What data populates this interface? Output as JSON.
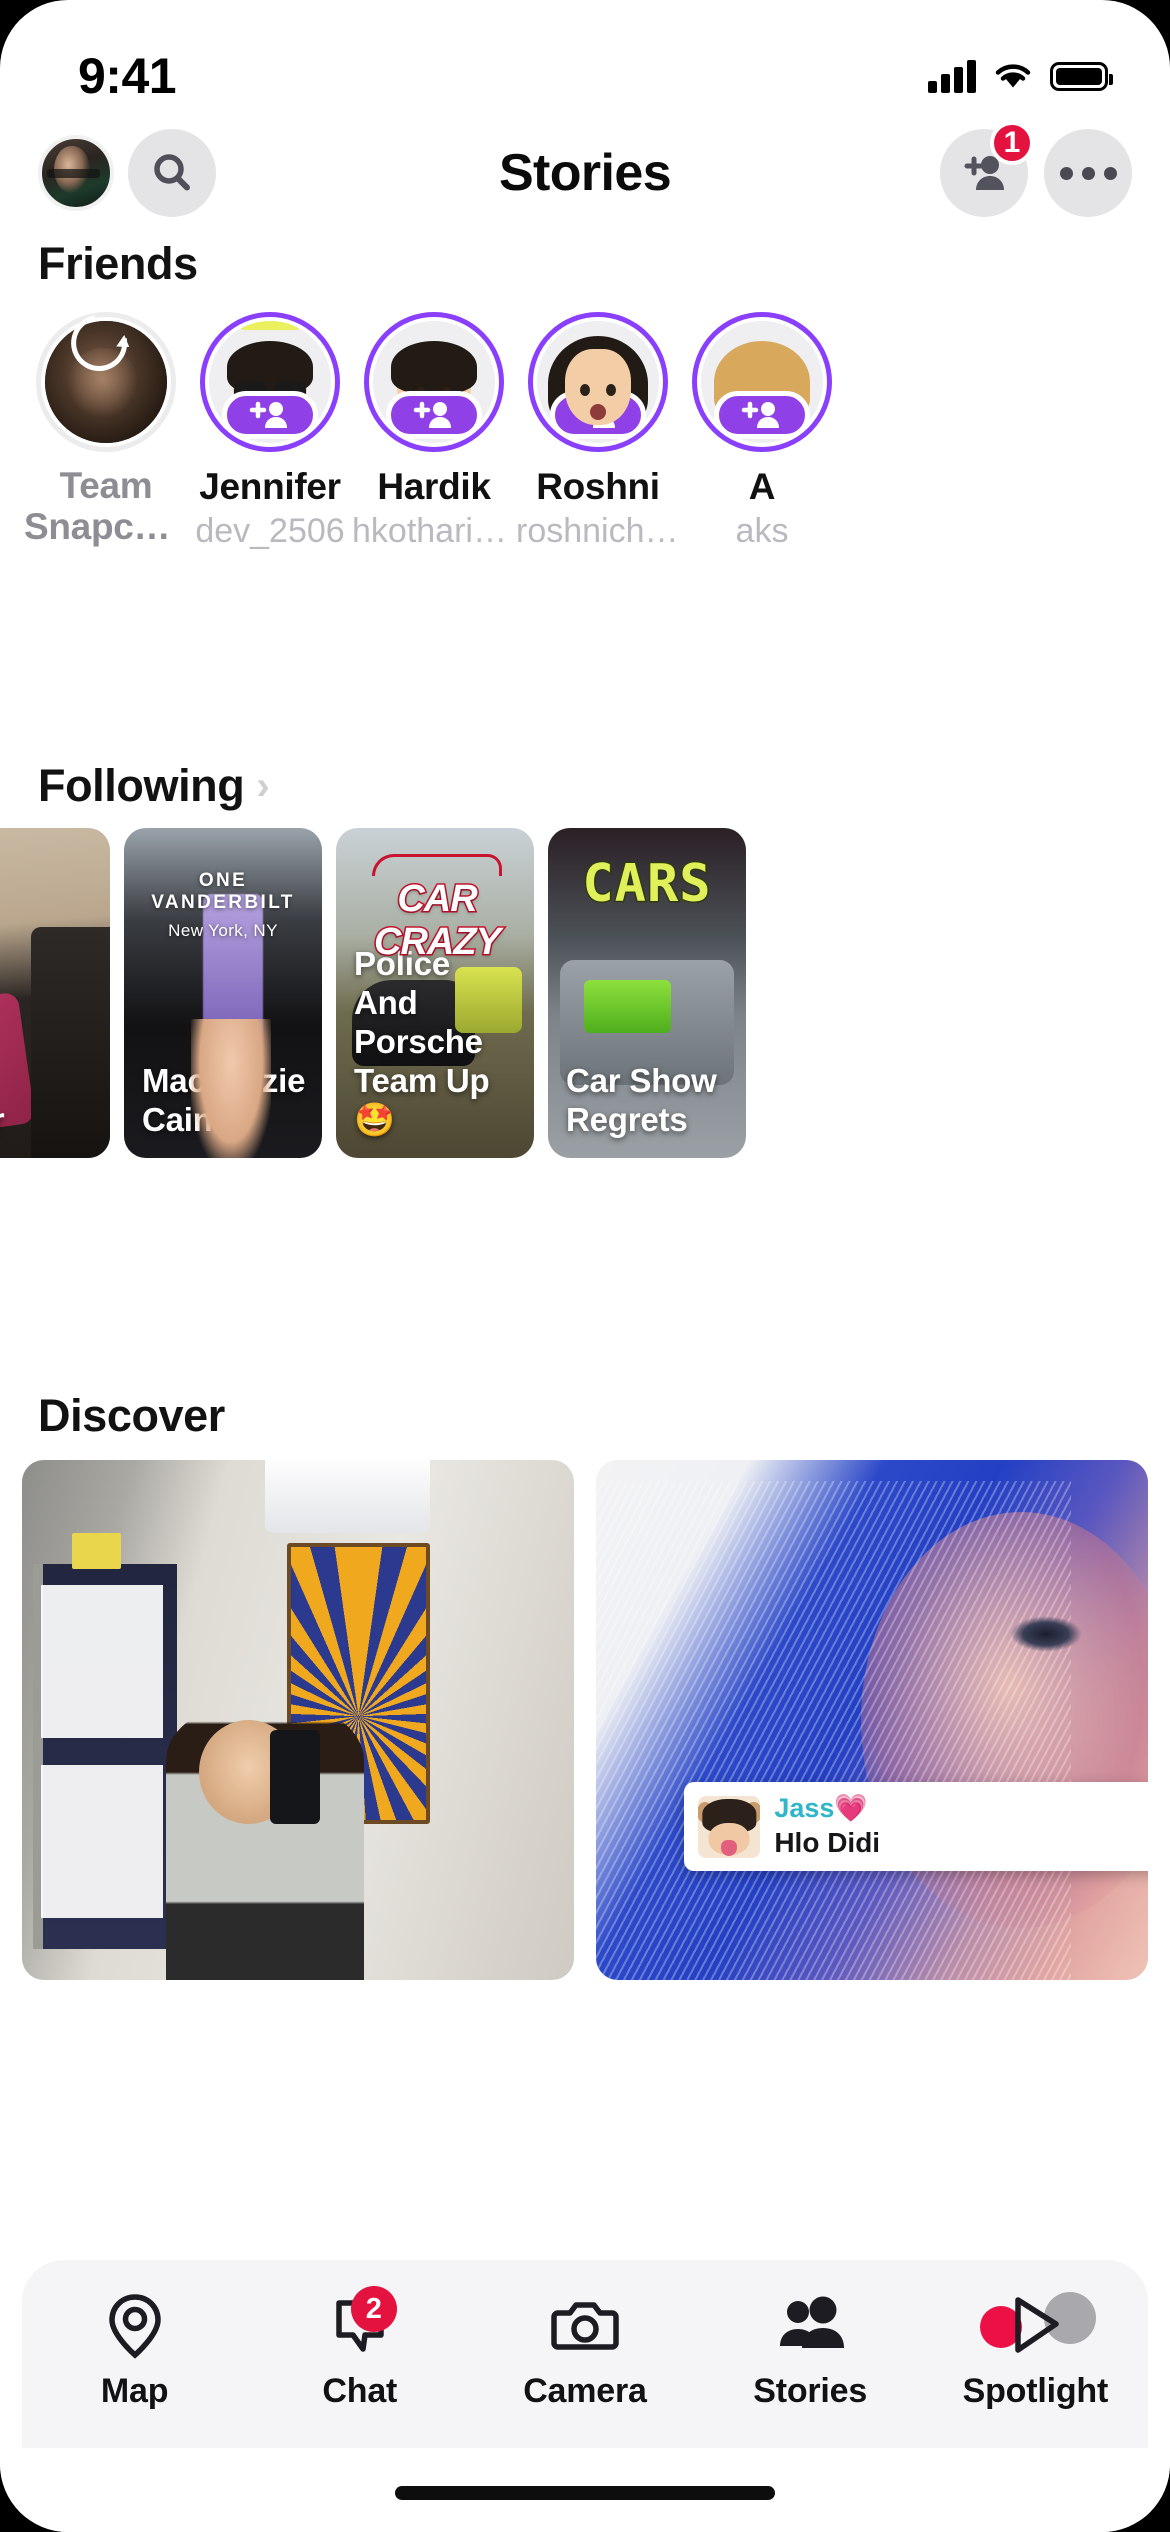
{
  "status_bar": {
    "time": "9:41"
  },
  "header": {
    "title": "Stories",
    "avatar_name": "profile-avatar",
    "search_label": "Search",
    "add_friend_badge": "1",
    "more_label": "More"
  },
  "friends_section": {
    "title": "Friends",
    "items": [
      {
        "name": "Team Snapchat",
        "username": "",
        "type": "photo",
        "ring": "gray",
        "muted": true,
        "has_add": false,
        "refreshing": true
      },
      {
        "name": "Jennifer",
        "username": "dev_2506",
        "type": "bitmoji-sunglasses",
        "ring": "purple",
        "muted": false,
        "has_add": true,
        "refreshing": false
      },
      {
        "name": "Hardik",
        "username": "hkothari1510",
        "type": "bitmoji-male",
        "ring": "purple",
        "muted": false,
        "has_add": true,
        "refreshing": false
      },
      {
        "name": "Roshni",
        "username": "roshnichav…",
        "type": "bitmoji-female",
        "ring": "purple",
        "muted": false,
        "has_add": true,
        "refreshing": false
      },
      {
        "name": "A",
        "username": "aks",
        "type": "bitmoji-blonde",
        "ring": "purple",
        "muted": false,
        "has_add": true,
        "refreshing": false
      }
    ]
  },
  "following_section": {
    "title": "Following",
    "chevron": "›",
    "cards": [
      {
        "title": "Kaur",
        "overlay": "",
        "overlay_sub": "",
        "style": "c1"
      },
      {
        "title": "Mackenzie Cain",
        "overlay": "ONE VANDERBILT",
        "overlay_sub": "New York, NY",
        "style": "c2"
      },
      {
        "title": "Police And Porsche Team Up 🤩",
        "overlay": "CAR CRAZY",
        "overlay_sub": "",
        "style": "c3"
      },
      {
        "title": "Car Show Regrets",
        "overlay": "CARS",
        "overlay_sub": "",
        "style": "c4"
      }
    ]
  },
  "discover_section": {
    "title": "Discover",
    "cards": [
      {
        "style": "d1",
        "chat": null
      },
      {
        "style": "d2",
        "chat": {
          "name": "Jass",
          "heart": "💗",
          "message": "Hlo Didi"
        }
      }
    ]
  },
  "bottom_nav": {
    "items": [
      {
        "label": "Map",
        "icon": "map-pin-icon",
        "badge": "",
        "active": false
      },
      {
        "label": "Chat",
        "icon": "chat-bubble-icon",
        "badge": "2",
        "active": false
      },
      {
        "label": "Camera",
        "icon": "camera-icon",
        "badge": "",
        "active": false
      },
      {
        "label": "Stories",
        "icon": "people-icon",
        "badge": "",
        "active": true
      },
      {
        "label": "Spotlight",
        "icon": "play-triangle-icon",
        "badge": "",
        "active": false
      }
    ]
  },
  "colors": {
    "accent_purple": "#8f40e6",
    "badge_red": "#e3123f",
    "nav_bg": "#f5f5f7",
    "chat_name_teal": "#2fb6c8"
  }
}
